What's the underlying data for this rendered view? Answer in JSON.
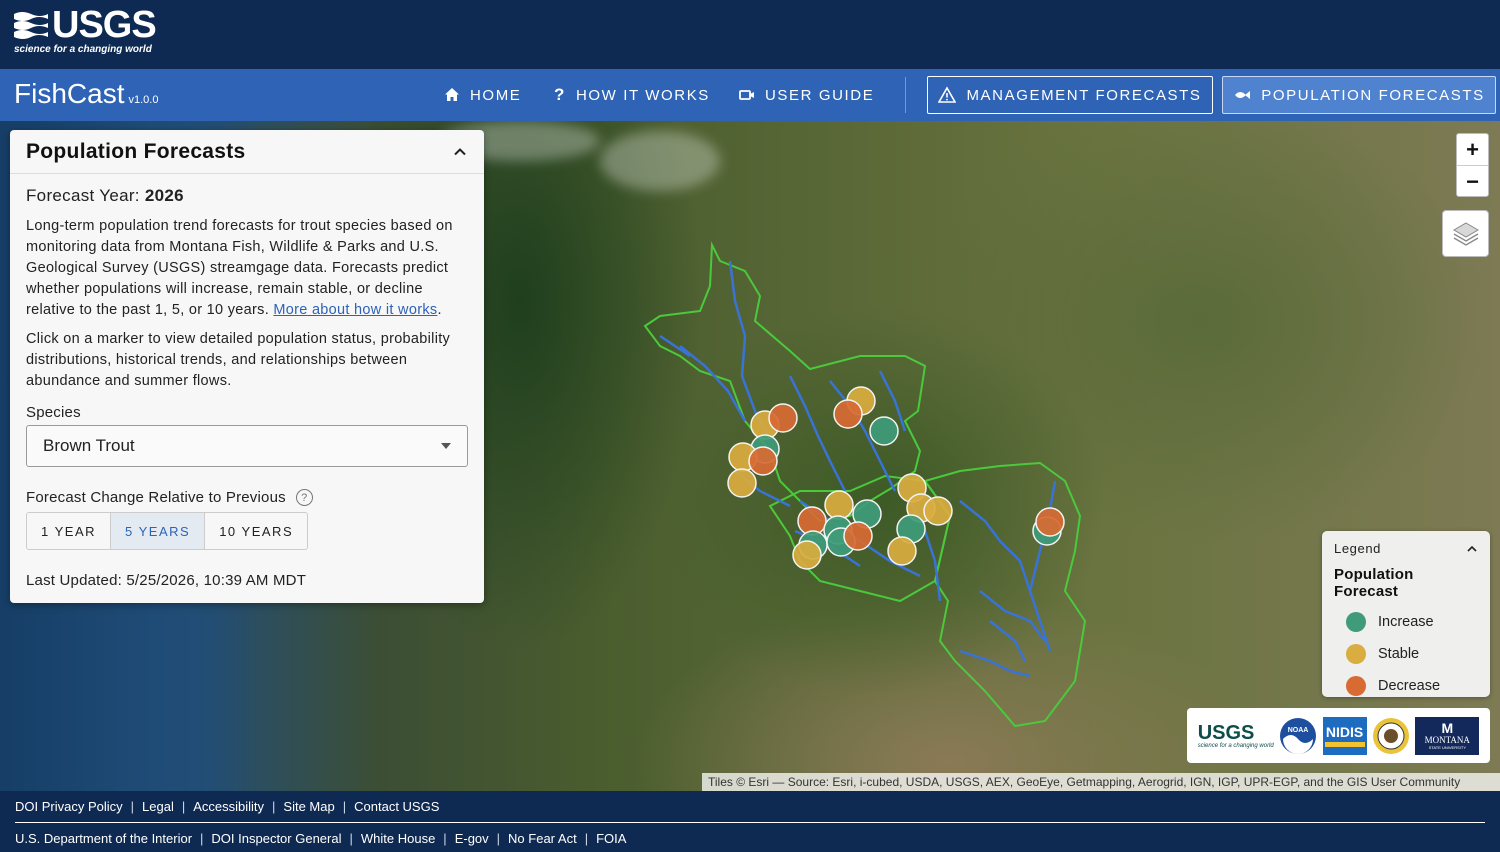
{
  "header": {
    "logo_word": "USGS",
    "logo_tagline": "science for a changing world"
  },
  "nav": {
    "app_name": "FishCast",
    "version": "v1.0.0",
    "home": "HOME",
    "how_it_works": "HOW IT WORKS",
    "user_guide": "USER GUIDE",
    "management_forecasts": "MANAGEMENT FORECASTS",
    "population_forecasts": "POPULATION FORECASTS"
  },
  "panel": {
    "title": "Population Forecasts",
    "forecast_year_label": "Forecast Year:",
    "forecast_year": "2026",
    "desc_1": "Long-term population trend forecasts for trout species based on monitoring data from Montana Fish, Wildlife & Parks and U.S. Geological Survey (USGS) streamgage data. Forecasts predict whether populations will increase, remain stable, or decline relative to the past 1, 5, or 10 years.",
    "more_link": "More about how it works",
    "desc_2": "Click on a marker to view detailed population status, probability distributions, historical trends, and relationships between abundance and summer flows.",
    "species_label": "Species",
    "species_value": "Brown Trout",
    "change_label": "Forecast Change Relative to Previous",
    "options": [
      "1 YEAR",
      "5 YEARS",
      "10 YEARS"
    ],
    "selected_option": "5 YEARS",
    "last_updated": "Last Updated: 5/25/2026, 10:39 AM MDT"
  },
  "map_controls": {
    "zoom_in": "+",
    "zoom_out": "−"
  },
  "legend": {
    "title": "Legend",
    "subtitle": "Population Forecast",
    "items": [
      {
        "label": "Increase",
        "color": "#3f9b78"
      },
      {
        "label": "Stable",
        "color": "#d9ad3f"
      },
      {
        "label": "Decrease",
        "color": "#d86a33"
      }
    ]
  },
  "partners": {
    "usgs": "USGS",
    "usgs_tag": "science for a changing world",
    "noaa": "NOAA",
    "nidis": "NIDIS",
    "msu_top": "M",
    "msu": "MONTANA",
    "msu_sub": "STATE UNIVERSITY"
  },
  "attribution": "Tiles © Esri — Source: Esri, i-cubed, USDA, USGS, AEX, GeoEye, Getmapping, Aerogrid, IGN, IGP, UPR-EGP, and the GIS User Community",
  "footer": {
    "row1": [
      "DOI Privacy Policy",
      "Legal",
      "Accessibility",
      "Site Map",
      "Contact USGS"
    ],
    "row2": [
      "U.S. Department of the Interior",
      "DOI Inspector General",
      "White House",
      "E-gov",
      "No Fear Act",
      "FOIA"
    ]
  },
  "colors": {
    "header_bg": "#0e2a52",
    "nav_bg": "#2e63b5",
    "increase": "#3f9b78",
    "stable": "#d9ad3f",
    "decrease": "#d86a33",
    "basin_outline": "#4bc93d",
    "stream": "#3a73d6"
  },
  "markers": [
    {
      "status": "stable"
    },
    {
      "status": "decrease"
    },
    {
      "status": "increase"
    },
    {
      "status": "stable"
    },
    {
      "status": "decrease"
    },
    {
      "status": "stable"
    },
    {
      "status": "stable"
    },
    {
      "status": "decrease"
    },
    {
      "status": "increase"
    },
    {
      "status": "stable"
    },
    {
      "status": "decrease"
    },
    {
      "status": "increase"
    },
    {
      "status": "increase"
    },
    {
      "status": "increase"
    },
    {
      "status": "increase"
    },
    {
      "status": "decrease"
    },
    {
      "status": "stable"
    },
    {
      "status": "stable"
    },
    {
      "status": "stable"
    },
    {
      "status": "stable"
    },
    {
      "status": "increase"
    },
    {
      "status": "stable"
    },
    {
      "status": "increase"
    },
    {
      "status": "decrease"
    }
  ]
}
